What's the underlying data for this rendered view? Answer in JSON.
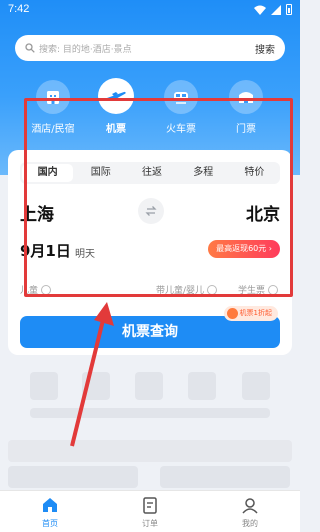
{
  "status_bar": {
    "time": "7:42"
  },
  "search": {
    "placeholder": "搜索: 目的地·酒店·景点",
    "button_label": "搜索"
  },
  "categories": [
    {
      "label": "酒店/民宿",
      "icon": "hotel-icon"
    },
    {
      "label": "机票",
      "icon": "plane-icon",
      "active": true
    },
    {
      "label": "火车票",
      "icon": "train-icon"
    },
    {
      "label": "门票",
      "icon": "ticket-icon"
    }
  ],
  "trip_tabs": [
    "国内",
    "国际",
    "往返",
    "多程",
    "特价"
  ],
  "active_tab": "国内",
  "route": {
    "from": "上海",
    "to": "北京"
  },
  "date": {
    "value": "9月1日",
    "weekday": "明天"
  },
  "promo_badge": "最高返现60元 ›",
  "options": [
    "儿童",
    "带儿童/婴儿",
    "学生票"
  ],
  "search_button": {
    "label": "机票查询",
    "badge": "机票1折起"
  },
  "bottom_nav": [
    {
      "label": "首页",
      "icon": "home-icon",
      "active": true
    },
    {
      "label": "订单",
      "icon": "order-icon"
    },
    {
      "label": "我的",
      "icon": "profile-icon"
    }
  ],
  "colors": {
    "brand": "#1e8cf5",
    "annotation": "#e23a3a",
    "promo": "#ff3b5c"
  }
}
